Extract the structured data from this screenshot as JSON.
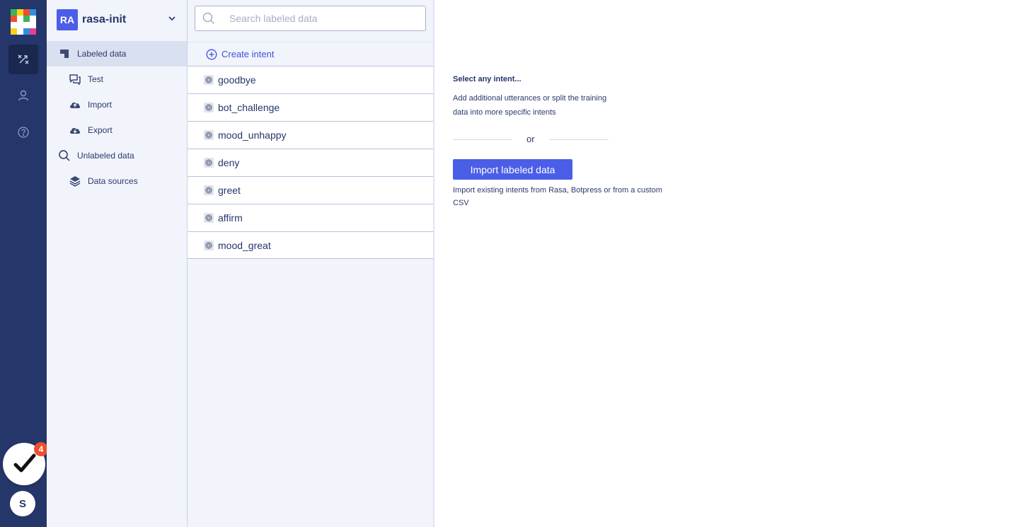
{
  "project": {
    "badge": "RA",
    "name": "rasa-init"
  },
  "nav": {
    "items": [
      {
        "label": "Labeled data",
        "icon": "labeled-data-icon"
      },
      {
        "label": "Test",
        "icon": "chat-icon"
      },
      {
        "label": "Import",
        "icon": "cloud-upload-icon"
      },
      {
        "label": "Export",
        "icon": "cloud-download-icon"
      },
      {
        "label": "Unlabeled data",
        "icon": "search-icon"
      },
      {
        "label": "Data sources",
        "icon": "layers-icon"
      }
    ]
  },
  "search": {
    "placeholder": "Search labeled data"
  },
  "create_intent": {
    "label": "Create intent"
  },
  "intents": [
    "goodbye",
    "bot_challenge",
    "mood_unhappy",
    "deny",
    "greet",
    "affirm",
    "mood_great"
  ],
  "empty_state": {
    "title": "Select any intent...",
    "description": "Add additional utterances or split the training data into more specific intents",
    "or": "or",
    "import_button": "Import labeled data",
    "import_description": "Import existing intents from Rasa, Botpress or from a custom CSV"
  },
  "todo": {
    "badge_count": "4"
  },
  "user": {
    "initial": "S"
  },
  "colors": {
    "rail": "#25366b",
    "accent": "#4a5ee8",
    "badge": "#ee4e2b"
  }
}
